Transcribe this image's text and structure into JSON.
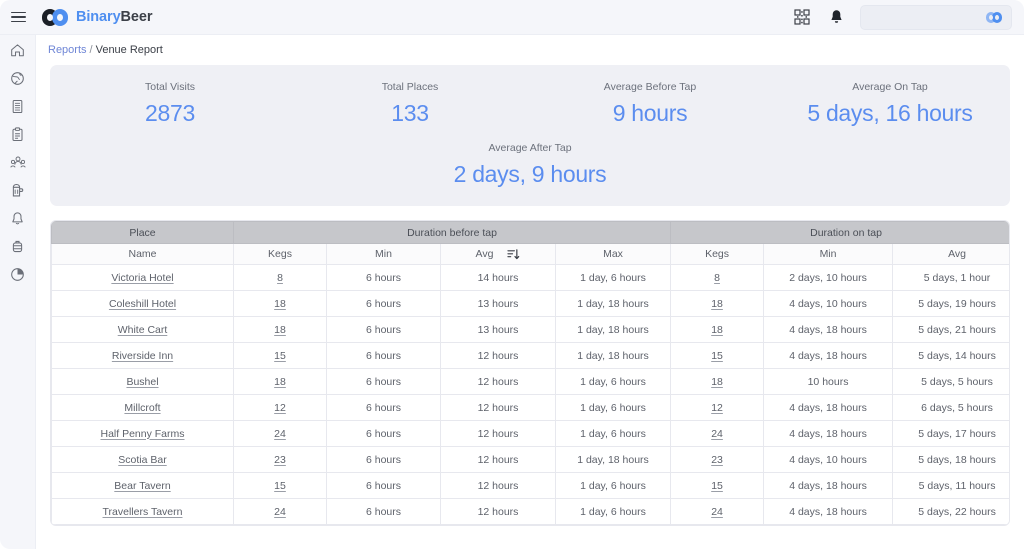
{
  "app": {
    "brand_first": "Binary",
    "brand_second": "Beer",
    "menu_icon": "hamburger-icon",
    "logo_icon": "binarybeer-logo-icon"
  },
  "topbar": {
    "qr_icon": "qr-scan-icon",
    "notification_icon": "bell-icon",
    "search_placeholder": "",
    "search_value": "",
    "account_logo_icon": "binarybeer-mini-logo-icon"
  },
  "sidebar": {
    "items": [
      {
        "name": "home",
        "icon": "home-icon"
      },
      {
        "name": "globe",
        "icon": "globe-icon"
      },
      {
        "name": "book",
        "icon": "book-icon"
      },
      {
        "name": "clipboard",
        "icon": "clipboard-icon"
      },
      {
        "name": "people",
        "icon": "people-icon"
      },
      {
        "name": "beer",
        "icon": "beer-mug-icon"
      },
      {
        "name": "alerts",
        "icon": "bell-icon"
      },
      {
        "name": "keg",
        "icon": "keg-icon"
      },
      {
        "name": "reports",
        "icon": "pie-chart-icon"
      }
    ]
  },
  "breadcrumb": {
    "parent": "Reports",
    "separator": "/",
    "current": "Venue Report"
  },
  "stats": {
    "row1": [
      {
        "label": "Total Visits",
        "value": "2873"
      },
      {
        "label": "Total Places",
        "value": "133"
      },
      {
        "label": "Average Before Tap",
        "value": "9 hours"
      },
      {
        "label": "Average On Tap",
        "value": "5 days, 16 hours"
      }
    ],
    "row2": [
      {
        "label": "Average After Tap",
        "value": "2 days, 9 hours"
      }
    ],
    "accent_color": "#5b8def"
  },
  "table": {
    "group_headers": [
      {
        "label": "Place",
        "span": 1
      },
      {
        "label": "Duration before tap",
        "span": 4
      },
      {
        "label": "Duration on tap",
        "span": 3
      }
    ],
    "sub_headers": [
      {
        "label": "Name",
        "sort": false
      },
      {
        "label": "Kegs",
        "sort": false
      },
      {
        "label": "Min",
        "sort": false
      },
      {
        "label": "Avg",
        "sort": true,
        "sort_icon": "sort-descending-icon"
      },
      {
        "label": "Max",
        "sort": false
      },
      {
        "label": "Kegs",
        "sort": false
      },
      {
        "label": "Min",
        "sort": false
      },
      {
        "label": "Avg",
        "sort": false
      }
    ],
    "rows": [
      {
        "place": "Victoria Hotel",
        "kegs_before": "8",
        "min_before": "6 hours",
        "avg_before": "14 hours",
        "max_before": "1 day, 6 hours",
        "kegs_on": "8",
        "min_on": "2 days, 10 hours",
        "avg_on": "5 days, 1 hour"
      },
      {
        "place": "Coleshill Hotel",
        "kegs_before": "18",
        "min_before": "6 hours",
        "avg_before": "13 hours",
        "max_before": "1 day, 18 hours",
        "kegs_on": "18",
        "min_on": "4 days, 10 hours",
        "avg_on": "5 days, 19 hours"
      },
      {
        "place": "White Cart",
        "kegs_before": "18",
        "min_before": "6 hours",
        "avg_before": "13 hours",
        "max_before": "1 day, 18 hours",
        "kegs_on": "18",
        "min_on": "4 days, 18 hours",
        "avg_on": "5 days, 21 hours"
      },
      {
        "place": "Riverside Inn",
        "kegs_before": "15",
        "min_before": "6 hours",
        "avg_before": "12 hours",
        "max_before": "1 day, 18 hours",
        "kegs_on": "15",
        "min_on": "4 days, 18 hours",
        "avg_on": "5 days, 14 hours"
      },
      {
        "place": "Bushel",
        "kegs_before": "18",
        "min_before": "6 hours",
        "avg_before": "12 hours",
        "max_before": "1 day, 6 hours",
        "kegs_on": "18",
        "min_on": "10 hours",
        "avg_on": "5 days, 5 hours"
      },
      {
        "place": "Millcroft",
        "kegs_before": "12",
        "min_before": "6 hours",
        "avg_before": "12 hours",
        "max_before": "1 day, 6 hours",
        "kegs_on": "12",
        "min_on": "4 days, 18 hours",
        "avg_on": "6 days, 5 hours"
      },
      {
        "place": "Half Penny Farms",
        "kegs_before": "24",
        "min_before": "6 hours",
        "avg_before": "12 hours",
        "max_before": "1 day, 6 hours",
        "kegs_on": "24",
        "min_on": "4 days, 18 hours",
        "avg_on": "5 days, 17 hours"
      },
      {
        "place": "Scotia Bar",
        "kegs_before": "23",
        "min_before": "6 hours",
        "avg_before": "12 hours",
        "max_before": "1 day, 18 hours",
        "kegs_on": "23",
        "min_on": "4 days, 10 hours",
        "avg_on": "5 days, 18 hours"
      },
      {
        "place": "Bear Tavern",
        "kegs_before": "15",
        "min_before": "6 hours",
        "avg_before": "12 hours",
        "max_before": "1 day, 6 hours",
        "kegs_on": "15",
        "min_on": "4 days, 18 hours",
        "avg_on": "5 days, 11 hours"
      },
      {
        "place": "Travellers Tavern",
        "kegs_before": "24",
        "min_before": "6 hours",
        "avg_before": "12 hours",
        "max_before": "1 day, 6 hours",
        "kegs_on": "24",
        "min_on": "4 days, 18 hours",
        "avg_on": "5 days, 22 hours"
      }
    ]
  }
}
